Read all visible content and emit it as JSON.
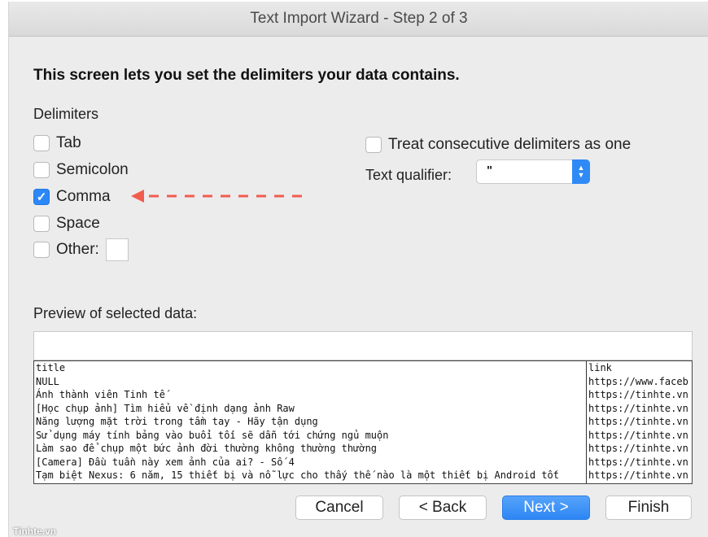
{
  "window": {
    "title": "Text Import Wizard - Step 2 of 3"
  },
  "heading": "This screen lets you set the delimiters your data contains.",
  "delimiters": {
    "label": "Delimiters",
    "tab": {
      "label": "Tab",
      "checked": false
    },
    "semicolon": {
      "label": "Semicolon",
      "checked": false
    },
    "comma": {
      "label": "Comma",
      "checked": true
    },
    "space": {
      "label": "Space",
      "checked": false
    },
    "other": {
      "label": "Other:",
      "checked": false,
      "value": ""
    }
  },
  "options": {
    "consecutive_label": "Treat consecutive delimiters as one",
    "consecutive_checked": false,
    "qualifier_label": "Text qualifier:",
    "qualifier_value": "\""
  },
  "preview": {
    "label": "Preview of selected data:",
    "rows": [
      [
        "title",
        "link"
      ],
      [
        "NULL",
        "https://www.faceb"
      ],
      [
        "Ảnh thành viên Tinh tế",
        "https://tinhte.vn"
      ],
      [
        "[Học chụp ảnh] Tìm hiểu về định dạng ảnh Raw",
        "https://tinhte.vn"
      ],
      [
        "Năng lượng mặt trời trong tầm tay - Hãy tận dụng",
        "https://tinhte.vn"
      ],
      [
        "Sử dụng máy tính bảng vào buổi tối sẽ dẫn tới chứng ngủ muộn",
        "https://tinhte.vn"
      ],
      [
        "Làm sao để chụp một bức ảnh đời thường không thường thường",
        "https://tinhte.vn"
      ],
      [
        "[Camera] Đầu tuần này xem ảnh của ai? - Số 4",
        "https://tinhte.vn"
      ],
      [
        "Tạm biệt Nexus: 6 năm, 15 thiết bị và nỗ lực cho thấy thế nào là một thiết bị Android tốt",
        "https://tinhte.vn"
      ]
    ]
  },
  "buttons": {
    "cancel": "Cancel",
    "back": "< Back",
    "next": "Next >",
    "finish": "Finish"
  },
  "watermark": "Tinhte.vn",
  "colors": {
    "accent": "#2d88f7",
    "annotation_arrow": "#f25c4e"
  }
}
